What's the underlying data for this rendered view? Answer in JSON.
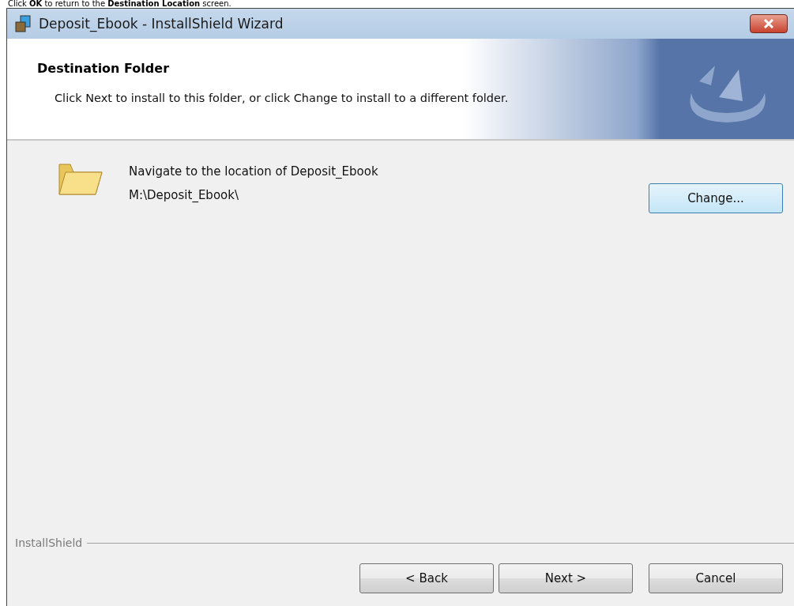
{
  "caption": "Click **OK** to return to the **Destination Location** screen.",
  "window": {
    "title": "Deposit_Ebook - InstallShield Wizard"
  },
  "header": {
    "title": "Destination Folder",
    "subtitle": "Click Next to install to this folder, or click Change to install to a different folder."
  },
  "location": {
    "prompt": "Navigate to the location of Deposit_Ebook",
    "path": "M:\\Deposit_Ebook\\",
    "change_button": {
      "label": "Change...",
      "focused": true
    }
  },
  "footer": {
    "brand": "InstallShield"
  },
  "buttons": [
    {
      "label": "< Back",
      "focused": false
    },
    {
      "label": "Next >",
      "focused": false
    },
    {
      "label": "Cancel",
      "focused": false
    }
  ]
}
